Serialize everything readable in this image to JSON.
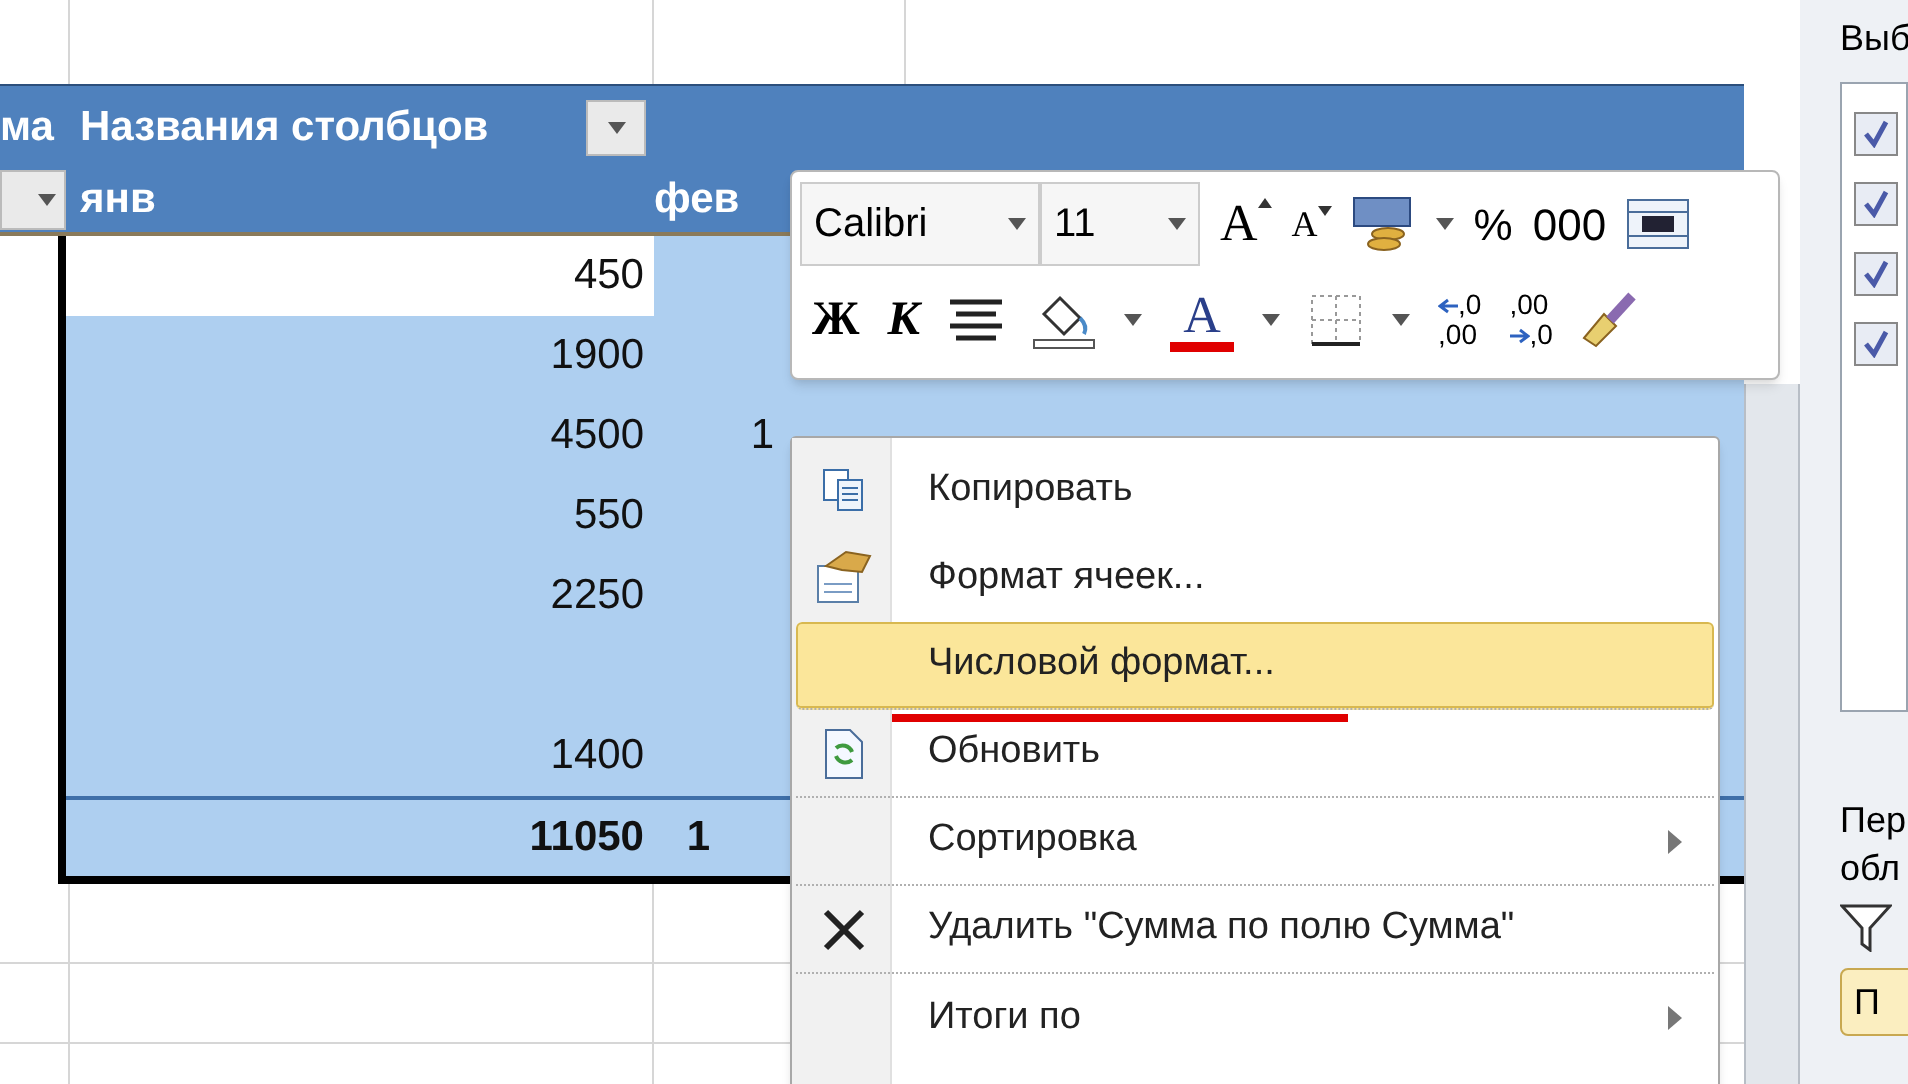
{
  "sheet": {
    "corner_header": "ма",
    "column_header": "Названия столбцов",
    "months": [
      "янв",
      "фев"
    ],
    "rows": [
      {
        "jan": "450",
        "active": true
      },
      {
        "jan": "1900",
        "active": false
      },
      {
        "jan": "4500",
        "feb": "1",
        "active": false
      },
      {
        "jan": "550",
        "active": false
      },
      {
        "jan": "2250",
        "active": false
      },
      {
        "active": false
      },
      {
        "jan": "1400",
        "active": false
      }
    ],
    "total": {
      "jan": "11050",
      "feb": "1"
    }
  },
  "mini_toolbar": {
    "font": "Calibri",
    "size": "11",
    "grow_font": "A",
    "shrink_font": "A",
    "percent": "%",
    "thousands": "000",
    "bold": "Ж",
    "italic": "К",
    "font_color": "A",
    "increase_decimal": [
      ",0",
      ",00"
    ],
    "decrease_decimal": [
      ",00",
      ",0"
    ]
  },
  "context_menu": [
    {
      "label": "Копировать",
      "kind": "copy",
      "selected": false,
      "divider": false
    },
    {
      "label": "Формат ячеек...",
      "kind": "format",
      "selected": false,
      "divider": false
    },
    {
      "label": "Числовой формат...",
      "kind": "plain",
      "selected": true,
      "divider": true
    },
    {
      "label": "Обновить",
      "kind": "refresh",
      "selected": false,
      "divider": true
    },
    {
      "label": "Сортировка",
      "kind": "submenu",
      "selected": false,
      "divider": true
    },
    {
      "label": "Удалить \"Сумма по полю Сумма\"",
      "kind": "delete",
      "selected": false,
      "divider": true
    },
    {
      "label": "Итоги по",
      "kind": "submenu",
      "selected": false,
      "divider": false
    }
  ],
  "field_panel": {
    "title": "Выб",
    "fields": [
      {
        "checked": true
      },
      {
        "checked": true
      },
      {
        "checked": true
      },
      {
        "checked": true
      }
    ],
    "areas_label": [
      "Пер",
      "обл"
    ],
    "button": "П"
  }
}
